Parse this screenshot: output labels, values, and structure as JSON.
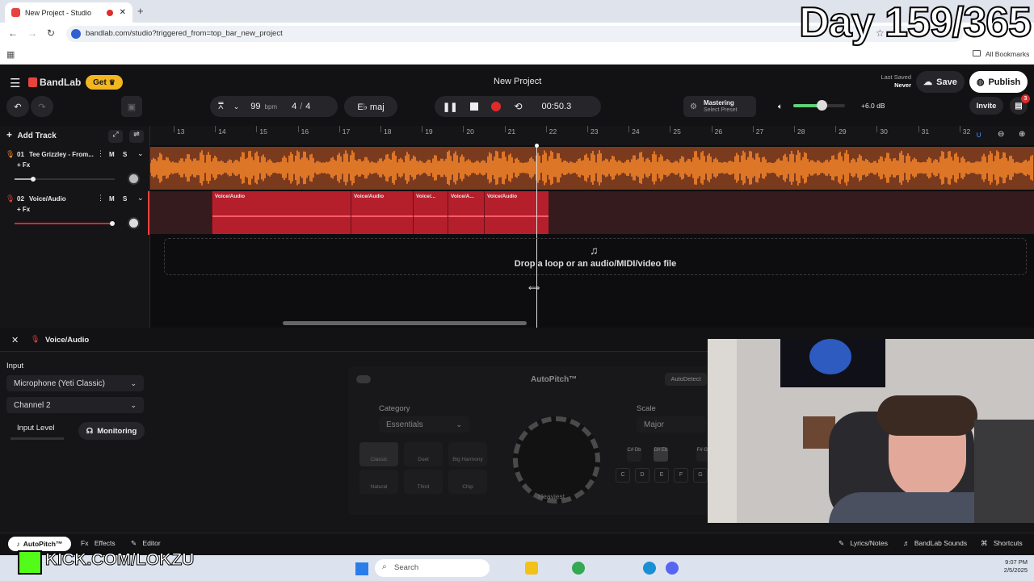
{
  "browser": {
    "tab_title": "New Project - Studio",
    "url": "bandlab.com/studio?triggered_from=top_bar_new_project",
    "bookmarks_label": "All Bookmarks",
    "overlay_text": "Day 159/365"
  },
  "app": {
    "brand": "BandLab",
    "get_label": "Get",
    "project_title": "New Project",
    "last_saved_label": "Last Saved",
    "last_saved_value": "Never",
    "save_label": "Save",
    "publish_label": "Publish",
    "invite_label": "Invite",
    "notification_count": "3"
  },
  "transport": {
    "bpm_value": "99",
    "bpm_unit": "bpm",
    "time_sig_num": "4",
    "time_sig_sep": "/",
    "time_sig_den": "4",
    "key_label": "E♭ maj",
    "time": "00:50.3",
    "mastering_label": "Mastering",
    "mastering_preset": "Select Preset",
    "volume_db": "+6.0 dB",
    "volume_level": 0.55,
    "accent": "#e8433f",
    "record_color": "#e02b2b"
  },
  "tracks": {
    "add_track_label": "Add Track",
    "items": [
      {
        "num": "01",
        "name": "Tee Grizzley - From...",
        "fx": "+ Fx",
        "m": "M",
        "s": "S",
        "color": "#ff8a2a"
      },
      {
        "num": "02",
        "name": "Voice/Audio",
        "fx": "+ Fx",
        "m": "M",
        "s": "S",
        "color": "#d9253a"
      }
    ],
    "clips": [
      "Voice/Audio",
      "Voice/Audio",
      "Voice/...",
      "Voice/A...",
      "Voice/Audio"
    ],
    "drop_text": "Drop a loop or an audio/MIDI/video file"
  },
  "ruler": [
    "13",
    "14",
    "15",
    "16",
    "17",
    "18",
    "19",
    "20",
    "21",
    "22",
    "23",
    "24",
    "25",
    "26",
    "27",
    "28",
    "29",
    "30",
    "31",
    "32"
  ],
  "editor": {
    "title": "Voice/Audio",
    "input_label": "Input",
    "device": "Microphone (Yeti Classic)",
    "channel": "Channel 2",
    "input_level_label": "Input Level",
    "monitoring_label": "Monitoring",
    "autopitch_title": "AutoPitch™",
    "autodetect_label": "AutoDetect",
    "category_label": "Category",
    "category_value": "Essentials",
    "scale_label": "Scale",
    "scale_value": "Major",
    "presets": [
      "Classic",
      "Duet",
      "Big Harmony",
      "Natural",
      "Third",
      "Chip"
    ],
    "knob_label": "Heaviest",
    "notes": [
      "C#",
      "Db",
      "D#",
      "Eb",
      "F#",
      "Gb",
      "C",
      "D",
      "E",
      "F",
      "G"
    ]
  },
  "bottom_tabs": {
    "autopitch": "AutoPitch™",
    "fx_prefix": "Fx",
    "effects": "Effects",
    "editor": "Editor",
    "lyrics": "Lyrics/Notes",
    "sounds": "BandLab Sounds",
    "shortcuts": "Shortcuts"
  },
  "taskbar": {
    "search_placeholder": "Search",
    "time": "9:07 PM",
    "date": "2/5/2025",
    "kick_text": "KICK.COM/LOKZU"
  }
}
